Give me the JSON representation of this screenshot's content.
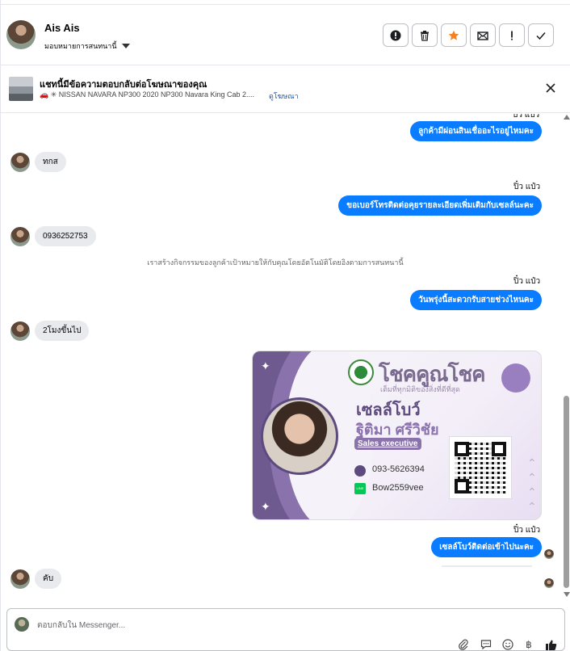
{
  "header": {
    "name": "Ais Ais",
    "assign_label": "มอบหมายการสนทนานี้",
    "actions": [
      {
        "icon": "alert-circle-icon",
        "label": "spam"
      },
      {
        "icon": "trash-icon",
        "label": "delete"
      },
      {
        "icon": "star-icon",
        "label": "star"
      },
      {
        "icon": "mail-envelope-icon",
        "label": "mark unread"
      },
      {
        "icon": "exclamation-icon",
        "label": "follow up"
      },
      {
        "icon": "check-icon",
        "label": "done"
      }
    ],
    "accent_star_color": "#f5821f"
  },
  "ad": {
    "title": "แชทนี้มีข้อความตอบกลับต่อโฆษณาของคุณ",
    "subtitle": "🚗 ✳ NISSAN NAVARA NP300 2020 NP300 Navara King Cab 2....",
    "link": "ดูโฆษณา"
  },
  "messages": {
    "m1_out": "ลูกค้ามีผ่อนสินเชื่ออะไรอยู่ไหมคะ",
    "m1_sender_partial": "บิว แปว",
    "m2_in": "ทกส",
    "m3_sender": "ปิ๋ว แป๋ว",
    "m3_out": "ขอเบอร์โทรติดต่อคุยรายละเอียดเพิ่มเติมกับเซลล์นะคะ",
    "m4_in": "0936252753",
    "system": "เราสร้างกิจกรรมของลูกค้าเป้าหมายให้กับคุณโดยอัตโนมัติโดยอิงตามการสนทนานี้",
    "m5_sender": "ปิ๋ว แป๋ว",
    "m5_out": "วันพรุ่งนี้สะดวกรับสายช่วงไหนคะ",
    "m6_in": "2โมงขึ้นไป",
    "m7_sender": "ปิ๋ว แป๋ว",
    "m7_out": "เซลล์โบว์ติดต่อเข้าไปนะคะ",
    "m8_in": "คับ"
  },
  "card": {
    "brand": "โชคคูณโชค",
    "tagline": "เต็มที่ทุกมิติของสิ่งที่ดีที่สุด",
    "nickname": "เซลล์โบว์",
    "fullname": "ฐิติมา ศรีวิชัย",
    "position": "Sales executive",
    "phone": "093-5626394",
    "line_label": "LINE",
    "line_id": "Bow2559vee"
  },
  "composer": {
    "placeholder": "ตอบกลับใน Messenger...",
    "icons": [
      "paperclip-icon",
      "saved-reply-icon",
      "emoji-icon",
      "baht-icon",
      "thumbs-up-icon"
    ]
  }
}
